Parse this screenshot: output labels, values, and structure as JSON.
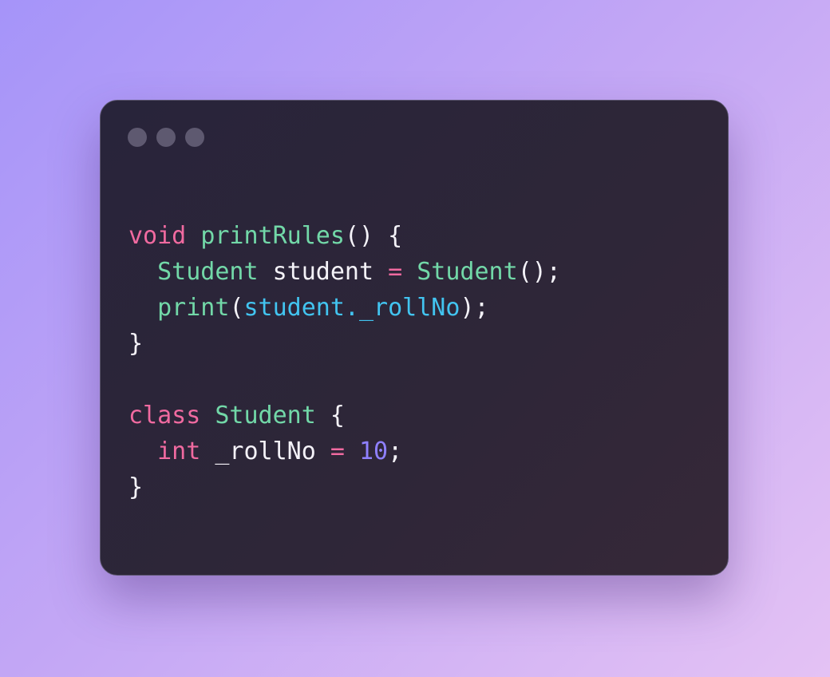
{
  "window": {
    "controls": [
      "dot-1",
      "dot-2",
      "dot-3"
    ]
  },
  "code": {
    "line1": {
      "kw": "void",
      "fn": "printRules",
      "rest": "() {"
    },
    "line2": {
      "type": "Student",
      "var": "student",
      "op": "=",
      "ctor": "Student",
      "rest": "();"
    },
    "line3": {
      "fn": "print",
      "open": "(",
      "arg": "student._rollNo",
      "rest": ");"
    },
    "line4": {
      "text": "}"
    },
    "line6": {
      "kw": "class",
      "name": "Student",
      "rest": "{"
    },
    "line7": {
      "type": "int",
      "var": "_rollNo",
      "op": "=",
      "num": "10",
      "rest": ";"
    },
    "line8": {
      "text": "}"
    }
  }
}
